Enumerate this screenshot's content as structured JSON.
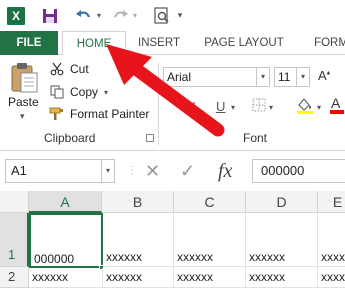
{
  "app": {
    "icon_letter": "X",
    "accent": "#217346"
  },
  "tabs": [
    {
      "label": "FILE"
    },
    {
      "label": "HOME"
    },
    {
      "label": "INSERT"
    },
    {
      "label": "PAGE LAYOUT"
    },
    {
      "label": "FORM"
    }
  ],
  "clipboard": {
    "paste": "Paste",
    "cut": "Cut",
    "copy": "Copy",
    "format_painter": "Format Painter",
    "group": "Clipboard"
  },
  "font": {
    "name": "Arial",
    "size": "11",
    "group": "Font",
    "color_accent": "#ff0000"
  },
  "formula_bar": {
    "name_box": "A1",
    "fx": "fx",
    "value": "000000"
  },
  "grid": {
    "columns": [
      "A",
      "B",
      "C",
      "D",
      "E"
    ],
    "rows": [
      {
        "num": "1",
        "cells": [
          "000000",
          "xxxxxx",
          "xxxxxx",
          "xxxxxx",
          "xxxxxx"
        ]
      },
      {
        "num": "2",
        "cells": [
          "xxxxxx",
          "xxxxxx",
          "xxxxxx",
          "xxxxxx",
          "xxxxxx"
        ]
      }
    ]
  },
  "annotation": {
    "arrow_color": "#e8141b"
  }
}
